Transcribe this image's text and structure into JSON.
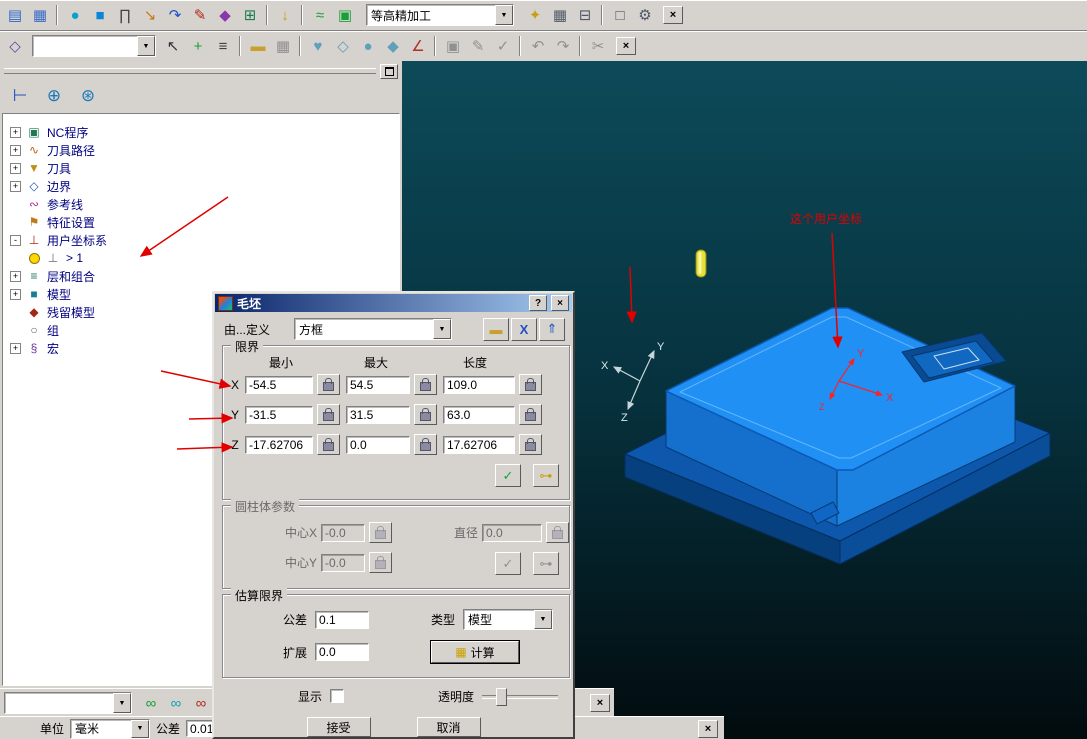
{
  "colors": {
    "window_bg": "#d6d3ce",
    "viewport_top": "#0d4a59",
    "viewport_bottom": "#020b0e",
    "model_blue": "#2090f4",
    "model_dark_blue": "#0a4a92",
    "annotation_red": "#e00000",
    "tree_text": "#000080",
    "title_gradient_left": "#0a246a",
    "title_gradient_right": "#a6caf0",
    "tool_yellow": "#e6e03c"
  },
  "toolbar_main": {
    "icons_left": [
      {
        "name": "printer-icon",
        "glyph": "▤",
        "color": "#2a66c8"
      },
      {
        "name": "save-project-icon",
        "glyph": "▦",
        "color": "#3a6ac8"
      },
      {
        "sep": true
      },
      {
        "name": "teapot-render-icon",
        "glyph": "●",
        "color": "#0aa0d0"
      },
      {
        "name": "block-icon",
        "glyph": "■",
        "color": "#0a86d8"
      },
      {
        "name": "rapid-heights-icon",
        "glyph": "∏",
        "color": "#404048"
      },
      {
        "name": "start-point-icon",
        "glyph": "↘",
        "color": "#c87818"
      },
      {
        "name": "leads-links-icon",
        "glyph": "↷",
        "color": "#2050c8"
      },
      {
        "name": "tool-pencil-icon",
        "glyph": "✎",
        "color": "#b02818"
      },
      {
        "name": "strategies-diamond-icon",
        "glyph": "◆",
        "color": "#8838a8"
      },
      {
        "name": "nc-program-icon",
        "glyph": "⊞",
        "color": "#1e7a50"
      },
      {
        "sep": true
      },
      {
        "name": "calculate-arrow-icon",
        "glyph": "↓",
        "color": "#c8a000"
      },
      {
        "sep": true
      },
      {
        "name": "simulation-icon",
        "glyph": "≈",
        "color": "#18a038"
      },
      {
        "name": "viewmill-icon",
        "glyph": "▣",
        "color": "#18a038"
      }
    ],
    "strategy_value": "等高精加工",
    "icons_right": [
      {
        "name": "key-icon",
        "glyph": "✦",
        "color": "#c8a018"
      },
      {
        "name": "table-icon",
        "glyph": "▦",
        "color": "#505868"
      },
      {
        "name": "calculator-icon",
        "glyph": "⊟",
        "color": "#505868"
      },
      {
        "sep": true
      },
      {
        "name": "window-grid-icon",
        "glyph": "□",
        "color": "#505868"
      },
      {
        "name": "hammer-tools-icon",
        "glyph": "⚙",
        "color": "#505868"
      }
    ],
    "close_glyph": "×"
  },
  "toolbar_second": {
    "lead_icons": [
      {
        "name": "curve-kite-icon",
        "glyph": "◇",
        "color": "#7040a8"
      }
    ],
    "combo_value": "",
    "icons": [
      {
        "name": "cursor-icon",
        "glyph": "↖",
        "color": "#303038"
      },
      {
        "name": "add-icon",
        "glyph": "+",
        "color": "#18a038"
      },
      {
        "name": "list-icon",
        "glyph": "≡",
        "color": "#404048"
      },
      {
        "sep": true
      },
      {
        "name": "folder-icon",
        "glyph": "▬",
        "color": "#c8a030"
      },
      {
        "name": "save-icon",
        "glyph": "▦",
        "disabled": true
      },
      {
        "sep": true
      },
      {
        "name": "heart-curve-icon",
        "glyph": "♥",
        "color": "#60a0b8"
      },
      {
        "name": "diamond-curve-icon",
        "glyph": "◇",
        "color": "#60a0b8"
      },
      {
        "name": "sphere-icon",
        "glyph": "●",
        "color": "#60a0b8"
      },
      {
        "name": "kite-icon",
        "glyph": "◆",
        "color": "#60a0b8"
      },
      {
        "name": "slope-icon",
        "glyph": "∠",
        "color": "#b03020"
      },
      {
        "sep": true
      },
      {
        "name": "box-select-icon",
        "glyph": "▣",
        "disabled": true
      },
      {
        "name": "pencil-edit-icon",
        "glyph": "✎",
        "disabled": true
      },
      {
        "name": "check-icon",
        "glyph": "✓",
        "disabled": true
      },
      {
        "sep": true
      },
      {
        "name": "undo-icon",
        "glyph": "↶",
        "disabled": true
      },
      {
        "name": "redo-icon",
        "glyph": "↷",
        "disabled": true
      },
      {
        "sep": true
      },
      {
        "name": "scissors-icon",
        "glyph": "✂",
        "disabled": true
      }
    ],
    "close_glyph": "×"
  },
  "explorer": {
    "toolbar_icons": [
      {
        "name": "tree-view-icon",
        "glyph": "⊢",
        "color": "#2050c0"
      },
      {
        "name": "globe-icon",
        "glyph": "⊕",
        "color": "#1878b8"
      },
      {
        "name": "globe-copy-icon",
        "glyph": "⊛",
        "color": "#1878b8"
      }
    ],
    "tree": [
      {
        "label": "NC程序",
        "expand": "+",
        "glyph": "▣",
        "color": "#1e7a50"
      },
      {
        "label": "刀具路径",
        "expand": "+",
        "glyph": "∿",
        "color": "#c06018"
      },
      {
        "label": "刀具",
        "expand": "+",
        "glyph": "▼",
        "color": "#c09018"
      },
      {
        "label": "边界",
        "expand": "+",
        "glyph": "◇",
        "color": "#2050c0"
      },
      {
        "label": "参考线",
        "glyph": "∾",
        "color": "#c030a0"
      },
      {
        "label": "特征设置",
        "glyph": "⚑",
        "color": "#c07818"
      },
      {
        "label": "用户坐标系",
        "expand": "-",
        "glyph": "⊥",
        "color": "#b02818"
      },
      {
        "label": "> 1",
        "glyph": "⊥",
        "color": "#707078"
      },
      {
        "label": "层和组合",
        "expand": "+",
        "glyph": "≡",
        "color": "#1e7a6a"
      },
      {
        "label": "模型",
        "expand": "+",
        "glyph": "■",
        "color": "#157f91"
      },
      {
        "label": "残留模型",
        "glyph": "◆",
        "color": "#a02818"
      },
      {
        "label": "组",
        "glyph": "○",
        "color": "#606068"
      },
      {
        "label": "宏",
        "expand": "+",
        "glyph": "§",
        "color": "#7030a0"
      }
    ]
  },
  "dialog": {
    "title": "毛坯",
    "help_glyph": "?",
    "close_glyph": "×",
    "defined_by_label": "由...定义",
    "defined_by_value": "方框",
    "header_icons": [
      {
        "name": "open-block-file-icon",
        "glyph": "▬",
        "color": "#c8a030"
      },
      {
        "name": "delete-block-icon",
        "glyph": "X",
        "color": "#2050c0"
      },
      {
        "name": "save-block-file-icon",
        "glyph": "⇑",
        "color": "#2050c0"
      }
    ],
    "limits": {
      "title": "限界",
      "headers": [
        "最小",
        "最大",
        "长度"
      ],
      "rows": [
        {
          "axis": "X",
          "min": "-54.5",
          "max": "54.5",
          "len": "109.0"
        },
        {
          "axis": "Y",
          "min": "-31.5",
          "max": "31.5",
          "len": "63.0"
        },
        {
          "axis": "Z",
          "min": "-17.62706",
          "max": "0.0",
          "len": "17.62706"
        }
      ]
    },
    "cylinder": {
      "title": "圆柱体参数",
      "center_x_label": "中心X",
      "center_x_value": "-0.0",
      "center_y_label": "中心Y",
      "center_y_value": "-0.0",
      "diameter_label": "直径",
      "diameter_value": "0.0"
    },
    "estimate": {
      "title": "估算限界",
      "tol_label": "公差",
      "tol_value": "0.1",
      "type_label": "类型",
      "type_value": "模型",
      "exp_label": "扩展",
      "exp_value": "0.0",
      "calc_label": "计算"
    },
    "display_label": "显示",
    "opacity_label": "透明度",
    "accept_label": "接受",
    "cancel_label": "取消"
  },
  "viewport": {
    "note": "这个用户坐标",
    "view_axes": {
      "x": "X",
      "y": "Y",
      "z": "Z"
    },
    "wp_axes": {
      "x": "X",
      "y": "Y",
      "z": "Z"
    }
  },
  "sim_bar": {
    "combo_value": "",
    "icons": [
      {
        "name": "glasses-green-icon",
        "glyph": "∞",
        "color": "#18a038"
      },
      {
        "name": "glasses-cyan-icon",
        "glyph": "∞",
        "color": "#18a0b8"
      },
      {
        "name": "glasses-exit-icon",
        "glyph": "∞",
        "color": "#b03020"
      }
    ],
    "close_glyph": "×"
  },
  "status_bar": {
    "units_label": "单位",
    "units_value": "毫米",
    "tol_label": "公差",
    "tol_value": "0.01",
    "close_glyph": "×"
  }
}
